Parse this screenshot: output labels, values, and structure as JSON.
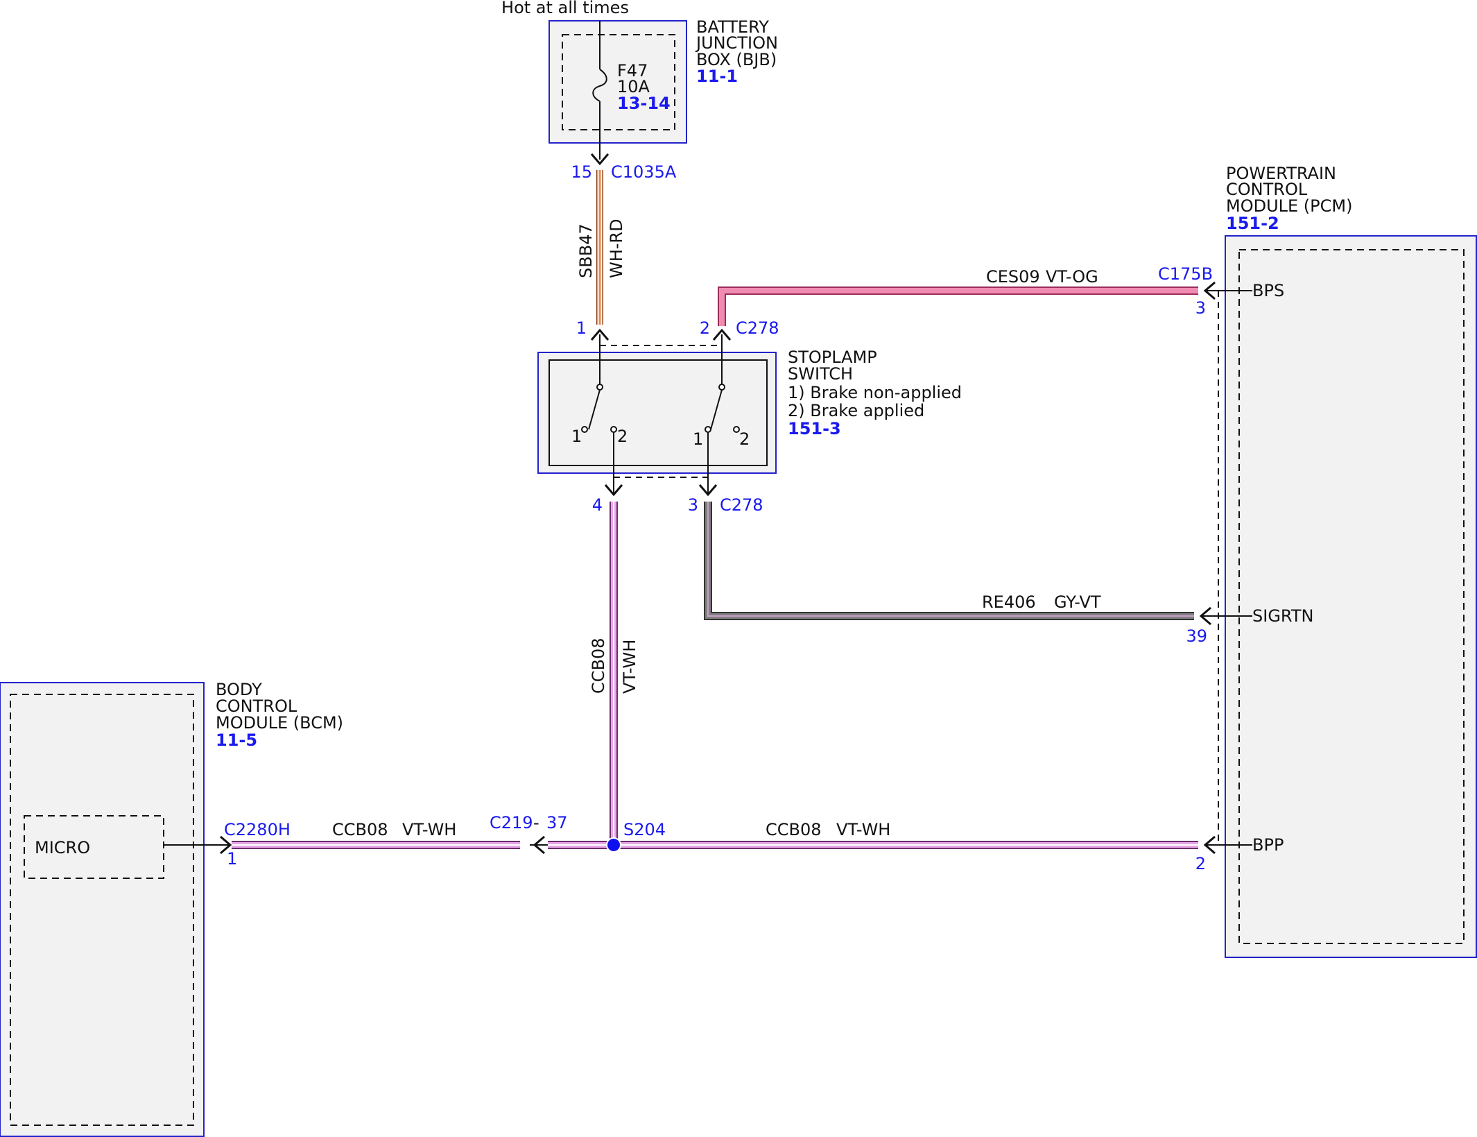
{
  "battery_junction_box": {
    "hot_label": "Hot at all times",
    "title_lines": [
      "BATTERY",
      "JUNCTION",
      "BOX (BJB)"
    ],
    "ref": "11-1",
    "fuse_name": "F47",
    "fuse_rating": "10A",
    "fuse_ref": "13-14",
    "pin": "15",
    "connector": "C1035A"
  },
  "wire_sbb47": {
    "circuit": "SBB47",
    "color": "WH-RD"
  },
  "stoplamp_switch": {
    "title_lines": [
      "STOPLAMP",
      "SWITCH"
    ],
    "state_1": "1) Brake non-applied",
    "state_2": "2) Brake applied",
    "ref": "151-3",
    "pin_top_left": "1",
    "pin_top_right": "2",
    "top_connector": "C278",
    "pin_bottom_left": "4",
    "pin_bottom_right": "3",
    "bottom_connector": "C278",
    "contact_a_pos1": "1",
    "contact_a_pos2": "2",
    "contact_b_pos1": "1",
    "contact_b_pos2": "2"
  },
  "pcm": {
    "title_lines": [
      "POWERTRAIN",
      "CONTROL",
      "MODULE (PCM)"
    ],
    "ref": "151-2",
    "connector": "C175B",
    "signals": [
      {
        "name": "BPS",
        "pin": "3"
      },
      {
        "name": "SIGRTN",
        "pin": "39"
      },
      {
        "name": "BPP",
        "pin": "2"
      }
    ]
  },
  "wire_ces09": {
    "circuit": "CES09",
    "color": "VT-OG"
  },
  "wire_re406": {
    "circuit": "RE406",
    "color": "GY-VT"
  },
  "wire_ccb08_vertical": {
    "circuit": "CCB08",
    "color": "VT-WH"
  },
  "wire_ccb08_left": {
    "circuit": "CCB08",
    "color": "VT-WH"
  },
  "wire_ccb08_right": {
    "circuit": "CCB08",
    "color": "VT-WH"
  },
  "inline_connector": {
    "name": "C219",
    "separator": "-",
    "pin": "37"
  },
  "splice": {
    "name": "S204"
  },
  "bcm": {
    "title_lines": [
      "BODY",
      "CONTROL",
      "MODULE (BCM)"
    ],
    "ref": "11-5",
    "internal_block": "MICRO",
    "connector": "C2280H",
    "pin": "1"
  },
  "colors": {
    "module_border": "#2222cc",
    "module_fill": "#f2f2f2",
    "label_blue": "#1a1aee",
    "wire_violet": "#e8a6e8",
    "wire_pink": "#f08cb0",
    "wire_gray": "#808080",
    "wire_orange": "#e3894a"
  }
}
